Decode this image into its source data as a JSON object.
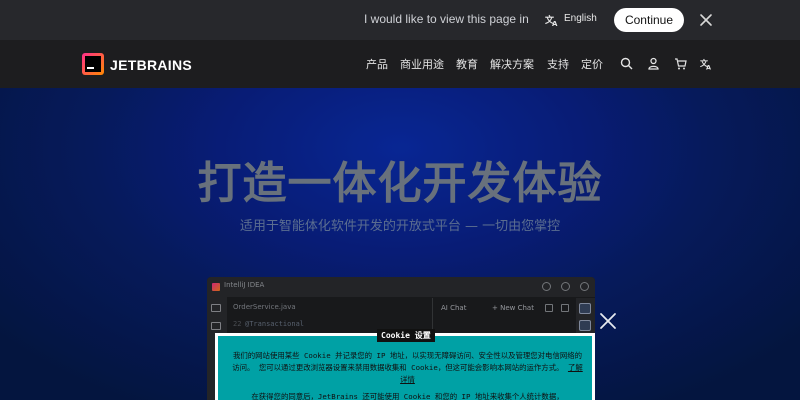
{
  "translate_bar": {
    "prompt": "I would like to view this page in",
    "language": "English",
    "continue_label": "Continue"
  },
  "nav": {
    "logo": "JETBRAINS",
    "items": [
      "产品",
      "商业用途",
      "教育",
      "解决方案",
      "支持",
      "定价"
    ],
    "icons": [
      "search-icon",
      "user-icon",
      "cart-icon",
      "translate-icon"
    ]
  },
  "hero": {
    "title": "打造一体化开发体验",
    "subtitle": "适用于智能体化软件开发的开放式平台 — 一切由您掌控"
  },
  "ide": {
    "title": "IntelliJ IDEA",
    "tab": "OrderService.java",
    "code_line": "@Transactional",
    "gutter": "22",
    "chat_title": "AI Chat",
    "chat_new": "+ New Chat"
  },
  "cookie": {
    "title": "Cookie 设置",
    "text": "我们的网站使用某些 Cookie 并记录您的 IP 地址，以实现无障碍访问、安全性以及管理您对电信网络的访问。 您可以通过更改浏览器设置来禁用数据收集和 Cookie，但这可能会影响本网站的运作方式。",
    "link": "了解详情",
    "text2": "在获得您的同意后，JetBrains 还可能使用 Cookie 和您的 IP 地址来收集个人统计数据，"
  },
  "colors": {
    "nav_bg": "#1d1d1f",
    "hero_blue": "#0a2fb4",
    "cookie_bg": "#00a1a5"
  }
}
